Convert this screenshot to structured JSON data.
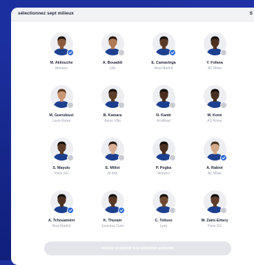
{
  "header": {
    "title": "sélectionnez sept milieux",
    "right_label": "S"
  },
  "players": [
    {
      "name": "M. Akliouche",
      "club": "Monaco",
      "selected": true,
      "skin": "#8a5a3c",
      "hair": "#1a120d",
      "jersey": "#1d3f8f"
    },
    {
      "name": "A. Bouaddi",
      "club": "Lille",
      "selected": false,
      "skin": "#b07a55",
      "hair": "#2a1a12",
      "jersey": "#1d3f8f"
    },
    {
      "name": "E. Camavinga",
      "club": "Real Madrid",
      "selected": true,
      "skin": "#5a3a26",
      "hair": "#15100c",
      "jersey": "#1d3f8f"
    },
    {
      "name": "Y. Fofana",
      "club": "AC Milan",
      "selected": false,
      "skin": "#4e3222",
      "hair": "#120d0a",
      "jersey": "#1d3f8f"
    },
    {
      "name": "M. Guendouzi",
      "club": "Lazio Rome",
      "selected": false,
      "skin": "#c99676",
      "hair": "#5a3a20",
      "jersey": "#1d3f8f"
    },
    {
      "name": "B. Kamara",
      "club": "Aston Villa",
      "selected": false,
      "skin": "#5e3d29",
      "hair": "#15100c",
      "jersey": "#1d3f8f"
    },
    {
      "name": "N. Kanté",
      "club": "Al-Ittihad",
      "selected": false,
      "skin": "#4a2f20",
      "hair": "#120d0a",
      "jersey": "#1d3f8f"
    },
    {
      "name": "M. Koné",
      "club": "AS Rome",
      "selected": false,
      "skin": "#4a2f20",
      "hair": "#120d0a",
      "jersey": "#1d3f8f"
    },
    {
      "name": "S. Mayulu",
      "club": "Paris-SG",
      "selected": false,
      "skin": "#5e3d29",
      "hair": "#15100c",
      "jersey": "#1d3f8f"
    },
    {
      "name": "E. Millot",
      "club": "Al Ahli",
      "selected": false,
      "skin": "#d9b096",
      "hair": "#2a1d14",
      "jersey": "#1d3f8f"
    },
    {
      "name": "P. Pogba",
      "club": "Monaco",
      "selected": false,
      "skin": "#4a2f20",
      "hair": "#120d0a",
      "jersey": "#1d3f8f"
    },
    {
      "name": "A. Rabiot",
      "club": "AC Milan",
      "selected": true,
      "skin": "#d4a98a",
      "hair": "#4a3420",
      "jersey": "#1d3f8f"
    },
    {
      "name": "A. Tchouaméni",
      "club": "Real Madrid",
      "selected": true,
      "skin": "#4e3222",
      "hair": "#120d0a",
      "jersey": "#1d3f8f"
    },
    {
      "name": "K. Thuram",
      "club": "Juventus Turin",
      "selected": true,
      "skin": "#5a3a26",
      "hair": "#15100c",
      "jersey": "#1d3f8f"
    },
    {
      "name": "C. Tolisso",
      "club": "Lyon",
      "selected": false,
      "skin": "#6e4a32",
      "hair": "#15100c",
      "jersey": "#1d3f8f"
    },
    {
      "name": "W. Zaïre-Emery",
      "club": "Paris-SG",
      "selected": false,
      "skin": "#5e3d29",
      "hair": "#15100c",
      "jersey": "#1d3f8f"
    }
  ],
  "submit_label": "valider et passer à la sélection suivante",
  "colors": {
    "selected_badge": "#2f6bd8",
    "unselected_badge": "#c9ccd3",
    "background": "#1c2f9e"
  }
}
